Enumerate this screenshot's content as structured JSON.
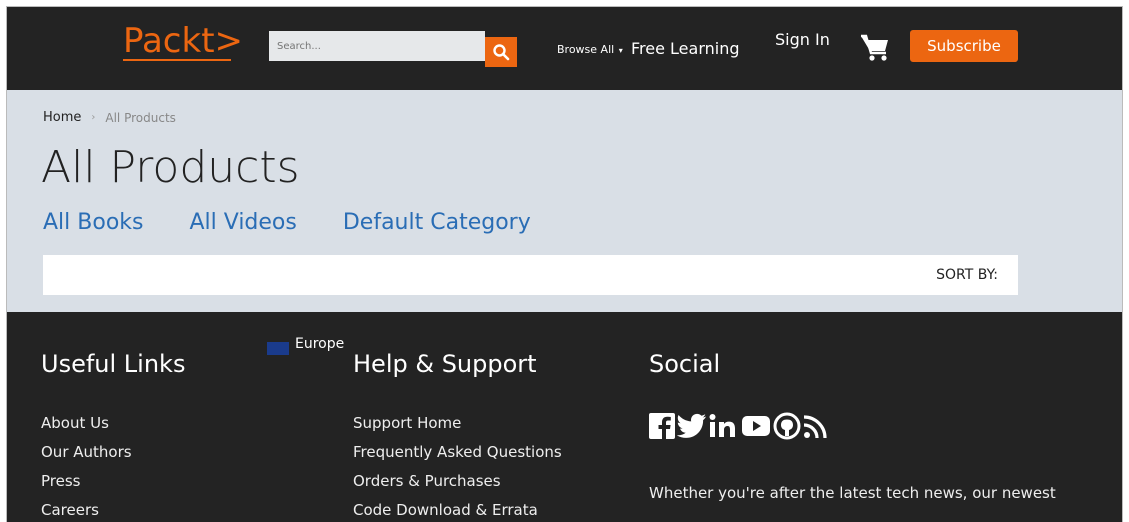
{
  "header": {
    "logo": "Packt>",
    "search_placeholder": "Search...",
    "browse_label": "Browse All",
    "free_learning": "Free Learning",
    "sign_in": "Sign In",
    "subscribe": "Subscribe",
    "accent_color": "#ec6611"
  },
  "breadcrumb": {
    "home": "Home",
    "current": "All Products"
  },
  "main": {
    "title": "All Products",
    "categories": [
      "All Books",
      "All Videos",
      "Default Category"
    ],
    "sort_label": "SORT BY:"
  },
  "footer": {
    "region": "Europe",
    "useful_links": {
      "title": "Useful Links",
      "items": [
        "About Us",
        "Our Authors",
        "Press",
        "Careers"
      ]
    },
    "help_support": {
      "title": "Help & Support",
      "items": [
        "Support Home",
        "Frequently Asked Questions",
        "Orders & Purchases",
        "Code Download & Errata"
      ]
    },
    "social": {
      "title": "Social",
      "icons": [
        "facebook-icon",
        "twitter-icon",
        "linkedin-icon",
        "youtube-icon",
        "github-icon",
        "rss-icon"
      ],
      "text": "Whether you're after the latest tech news, our newest"
    }
  }
}
